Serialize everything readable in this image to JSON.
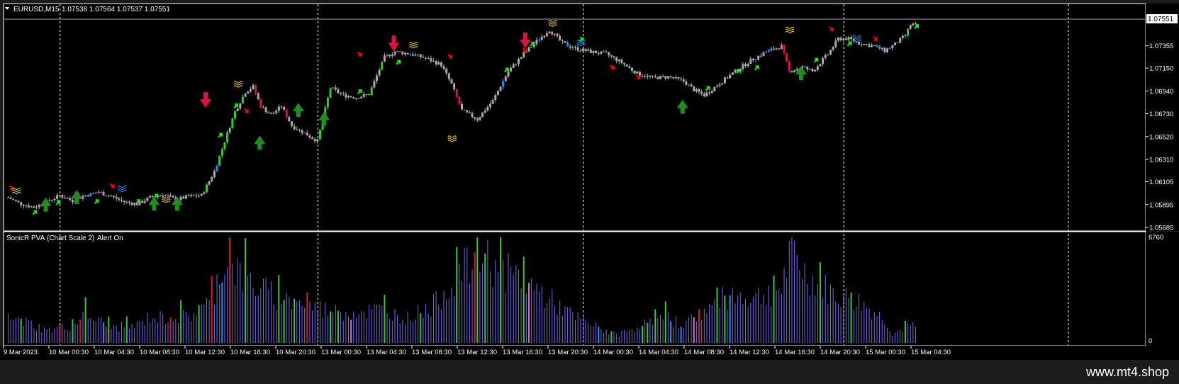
{
  "window": {
    "symbol_title": "EURUSD,M15",
    "ohlc": "1.07538 1.07564 1.07537 1.07551",
    "current_price_label": "1.07551"
  },
  "indicator": {
    "title": "SonicR PVA",
    "scale": "(Chart Scale 2)",
    "alert": "Alert On",
    "max_label": "6760",
    "zero_label": "0"
  },
  "watermark": "www.mt4.shop",
  "colors": {
    "background": "#000000",
    "frame": "#ffffff",
    "bull_candle": "#32cd32",
    "bear_candle": "#dc143c",
    "neutral_candle": "#a9a9a9",
    "climax_blue": "#1e90ff",
    "climax_violet": "#da70d6",
    "volume_neutral": "#7b68ee",
    "arrow_up": "#00ff00",
    "arrow_up_big": "#228b22",
    "arrow_down": "#ff0000",
    "wave_yellow": "#ffd700",
    "wave_blue": "#1e90ff"
  },
  "chart_data": [
    {
      "type": "candlestick",
      "symbol": "EURUSD",
      "timeframe": "M15",
      "y_ticks": [
        "1.07551",
        "1.07355",
        "1.07150",
        "1.06940",
        "1.06730",
        "1.06520",
        "1.06310",
        "1.06105",
        "1.05895",
        "1.05685"
      ],
      "ylim": [
        1.05685,
        1.076
      ],
      "x_ticks": [
        "9 Mar 2023",
        "10 Mar 00:30",
        "10 Mar 04:30",
        "10 Mar 08:30",
        "10 Mar 12:30",
        "10 Mar 16:30",
        "10 Mar 20:30",
        "13 Mar 00:30",
        "13 Mar 04:30",
        "13 Mar 08:30",
        "13 Mar 12:30",
        "13 Mar 16:30",
        "13 Mar 20:30",
        "14 Mar 00:30",
        "14 Mar 04:30",
        "14 Mar 08:30",
        "14 Mar 12:30",
        "14 Mar 16:30",
        "14 Mar 20:30",
        "15 Mar 00:30",
        "15 Mar 04:30"
      ],
      "close_path": [
        [
          0,
          1.0596
        ],
        [
          5,
          1.059
        ],
        [
          10,
          1.0587
        ],
        [
          15,
          1.0592
        ],
        [
          20,
          1.0598
        ],
        [
          25,
          1.0593
        ],
        [
          30,
          1.0598
        ],
        [
          35,
          1.0601
        ],
        [
          40,
          1.0597
        ],
        [
          45,
          1.0592
        ],
        [
          50,
          1.059
        ],
        [
          55,
          1.0596
        ],
        [
          60,
          1.0599
        ],
        [
          65,
          1.0594
        ],
        [
          70,
          1.0597
        ],
        [
          75,
          1.0598
        ],
        [
          80,
          1.062
        ],
        [
          84,
          1.0648
        ],
        [
          88,
          1.0675
        ],
        [
          92,
          1.0693
        ],
        [
          95,
          1.0698
        ],
        [
          98,
          1.068
        ],
        [
          102,
          1.0672
        ],
        [
          106,
          1.068
        ],
        [
          110,
          1.0662
        ],
        [
          115,
          1.0655
        ],
        [
          120,
          1.0648
        ],
        [
          125,
          1.0697
        ],
        [
          130,
          1.069
        ],
        [
          135,
          1.0688
        ],
        [
          140,
          1.0691
        ],
        [
          146,
          1.0725
        ],
        [
          150,
          1.073
        ],
        [
          156,
          1.0728
        ],
        [
          162,
          1.0724
        ],
        [
          168,
          1.0718
        ],
        [
          172,
          1.07
        ],
        [
          176,
          1.0676
        ],
        [
          182,
          1.0668
        ],
        [
          188,
          1.0685
        ],
        [
          194,
          1.0712
        ],
        [
          200,
          1.0728
        ],
        [
          206,
          1.0742
        ],
        [
          210,
          1.075
        ],
        [
          215,
          1.0738
        ],
        [
          220,
          1.0733
        ],
        [
          226,
          1.073
        ],
        [
          232,
          1.0728
        ],
        [
          238,
          1.072
        ],
        [
          244,
          1.071
        ],
        [
          250,
          1.0706
        ],
        [
          256,
          1.0707
        ],
        [
          262,
          1.0703
        ],
        [
          266,
          1.0695
        ],
        [
          270,
          1.069
        ],
        [
          276,
          1.0701
        ],
        [
          282,
          1.0712
        ],
        [
          288,
          1.0722
        ],
        [
          294,
          1.073
        ],
        [
          300,
          1.0735
        ],
        [
          303,
          1.0712
        ],
        [
          308,
          1.0716
        ],
        [
          312,
          1.0712
        ],
        [
          318,
          1.0728
        ],
        [
          322,
          1.0742
        ],
        [
          326,
          1.0742
        ],
        [
          330,
          1.0738
        ],
        [
          336,
          1.0735
        ],
        [
          340,
          1.0731
        ],
        [
          344,
          1.0737
        ],
        [
          348,
          1.0745
        ],
        [
          350,
          1.0755
        ],
        [
          352,
          1.0755
        ]
      ],
      "bars_total": 352,
      "session_separators": [
        "9 Mar 2023 / 10 Mar",
        "10 Mar / 13 Mar",
        "13 Mar / 14 Mar",
        "14 Mar / 15 Mar"
      ]
    },
    {
      "type": "bar",
      "title": "SonicR PVA",
      "ylim": [
        0,
        6760
      ],
      "x_ticks": [
        "9 Mar 2023",
        "10 Mar 00:30",
        "10 Mar 04:30",
        "10 Mar 08:30",
        "10 Mar 12:30",
        "10 Mar 16:30",
        "10 Mar 20:30",
        "13 Mar 00:30",
        "13 Mar 04:30",
        "13 Mar 08:30",
        "13 Mar 12:30",
        "13 Mar 16:30",
        "13 Mar 20:30",
        "14 Mar 00:30",
        "14 Mar 04:30",
        "14 Mar 08:30",
        "14 Mar 12:30",
        "14 Mar 16:30",
        "14 Mar 20:30",
        "15 Mar 00:30",
        "15 Mar 04:30"
      ],
      "volume_path": [
        [
          0,
          1500
        ],
        [
          8,
          1300
        ],
        [
          15,
          800
        ],
        [
          25,
          1100
        ],
        [
          30,
          1800
        ],
        [
          40,
          1000
        ],
        [
          50,
          1100
        ],
        [
          55,
          1700
        ],
        [
          60,
          1600
        ],
        [
          70,
          1700
        ],
        [
          78,
          2500
        ],
        [
          85,
          5800
        ],
        [
          90,
          4300
        ],
        [
          98,
          3500
        ],
        [
          105,
          2800
        ],
        [
          115,
          2500
        ],
        [
          125,
          2000
        ],
        [
          132,
          2000
        ],
        [
          145,
          2100
        ],
        [
          155,
          1600
        ],
        [
          165,
          2400
        ],
        [
          175,
          4500
        ],
        [
          185,
          5500
        ],
        [
          192,
          4600
        ],
        [
          200,
          4000
        ],
        [
          210,
          2800
        ],
        [
          220,
          1600
        ],
        [
          230,
          900
        ],
        [
          236,
          500
        ],
        [
          245,
          1100
        ],
        [
          255,
          1600
        ],
        [
          262,
          1200
        ],
        [
          270,
          2000
        ],
        [
          280,
          3100
        ],
        [
          290,
          2900
        ],
        [
          300,
          3500
        ],
        [
          304,
          5800
        ],
        [
          310,
          4200
        ],
        [
          320,
          3100
        ],
        [
          330,
          2600
        ],
        [
          340,
          1500
        ],
        [
          343,
          600
        ],
        [
          350,
          1100
        ],
        [
          352,
          1000
        ]
      ],
      "highlight_colors": [
        "green",
        "red",
        "blue",
        "violet",
        "neutral"
      ]
    }
  ],
  "signals": {
    "up_arrows": [
      [
        10,
        1.0587
      ],
      [
        19,
        1.0596
      ],
      [
        34,
        1.0597
      ],
      [
        50,
        1.0597
      ],
      [
        57,
        1.0602
      ],
      [
        82,
        1.0658
      ],
      [
        88,
        1.0685
      ],
      [
        136,
        1.0698
      ],
      [
        151,
        1.0725
      ],
      [
        193,
        1.0718
      ],
      [
        203,
        1.0742
      ],
      [
        222,
        1.0746
      ],
      [
        271,
        1.0701
      ],
      [
        283,
        1.0717
      ],
      [
        290,
        1.072
      ],
      [
        313,
        1.0727
      ],
      [
        326,
        1.0742
      ],
      [
        352,
        1.0758
      ]
    ],
    "down_arrows": [
      [
        1,
        1.0599
      ],
      [
        40,
        1.0601
      ],
      [
        92,
        1.067
      ],
      [
        136,
        1.0722
      ],
      [
        171,
        1.072
      ],
      [
        200,
        1.0726
      ],
      [
        234,
        1.071
      ],
      [
        244,
        1.0701
      ],
      [
        319,
        1.0745
      ],
      [
        336,
        1.0736
      ]
    ],
    "big_up_arrows": [
      [
        15,
        1.0583
      ],
      [
        27,
        1.059
      ],
      [
        57,
        1.0584
      ],
      [
        66,
        1.0584
      ],
      [
        98,
        1.064
      ],
      [
        113,
        1.067
      ],
      [
        123,
        1.0662
      ],
      [
        262,
        1.0673
      ],
      [
        308,
        1.0704
      ]
    ],
    "big_down_arrows": [
      [
        77,
        1.0685
      ],
      [
        150,
        1.0737
      ],
      [
        201,
        1.074
      ]
    ]
  }
}
